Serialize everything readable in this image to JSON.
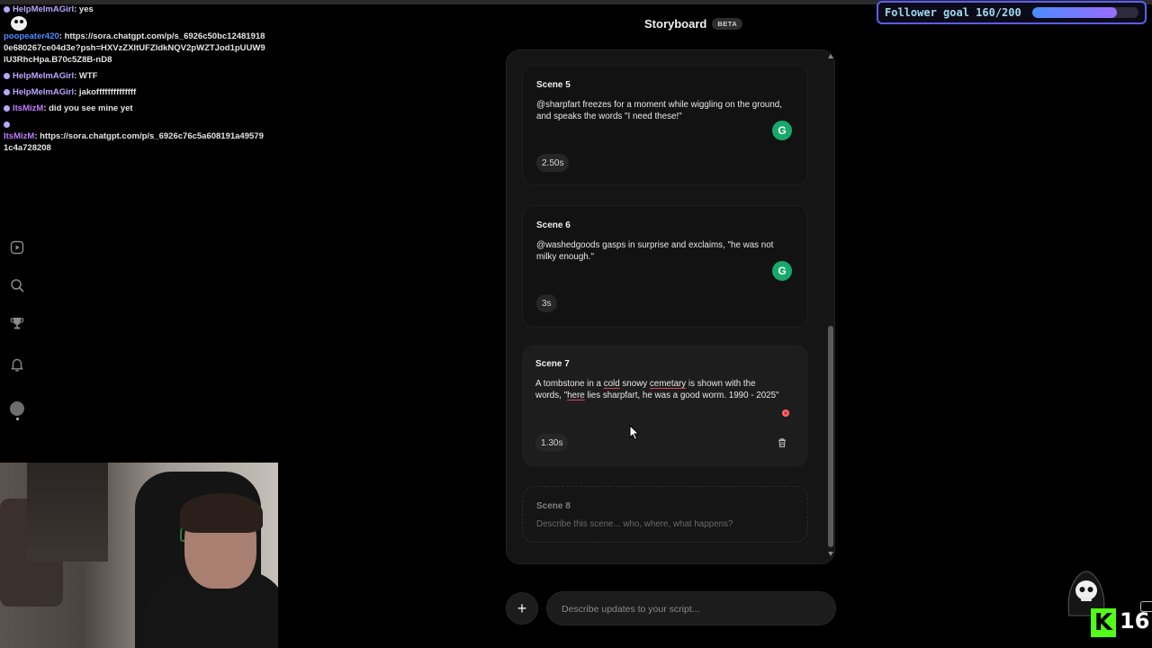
{
  "chat": {
    "messages": [
      {
        "user": "HelpMeImAGirl",
        "text": "yes",
        "color": "#b9a6ff"
      },
      {
        "user": "poopeater420",
        "text": "https://sora.chatgpt.com/p/s_6926c50bc124819180e680267ce04d3e?psh=HXVzZXItUFZldkNQV2pWZTJod1pUUW9lU3RhcHpa.B70c5Z8B-nD8",
        "color": "#4f8cff"
      },
      {
        "user": "HelpMeImAGirl",
        "text": "WTF",
        "color": "#b9a6ff"
      },
      {
        "user": "HelpMeImAGirl",
        "text": "jakoffffffffffffff",
        "color": "#b9a6ff"
      },
      {
        "user": "ItsMizM",
        "text": "did you see mine yet",
        "color": "#c07cff"
      },
      {
        "user": "ItsMizM",
        "text": "https://sora.chatgpt.com/p/s_6926c76c5a608191a495791c4a728208",
        "color": "#c07cff"
      }
    ]
  },
  "nav": {
    "icons": [
      "play-icon",
      "search-icon",
      "trophy-icon",
      "bell-icon",
      "avatar"
    ]
  },
  "header": {
    "title": "Storyboard",
    "badge": "BETA"
  },
  "follower_goal": {
    "label": "Follower goal 160/200",
    "current": 160,
    "target": 200,
    "progress": 0.8,
    "border_color": "#5b5ef0",
    "fill_color": "#7a7cff"
  },
  "scenes": [
    {
      "title": "Scene 5",
      "text": "@sharpfart freezes for a moment while wiggling on the ground, and speaks the words \"I need these!\"",
      "duration": "2.50s"
    },
    {
      "title": "Scene 6",
      "text": "@washedgoods gasps in surprise and exclaims, \"he was not milky enough.\"",
      "duration": "3s"
    },
    {
      "title": "Scene 7",
      "text_parts": [
        "A tombstone in a ",
        "cold",
        " snowy ",
        "cemetary",
        " is shown with the words, \"",
        "here",
        " lies sharpfart, he was a good worm. 1990 - 2025\""
      ],
      "duration": "1.30s"
    },
    {
      "title": "Scene 8",
      "placeholder": "Describe this scene... who, where, what happens?"
    }
  ],
  "composer": {
    "add_label": "+",
    "placeholder": "Describe updates to your script..."
  },
  "kick": {
    "logo": "K",
    "count": "16"
  },
  "colors": {
    "accent_green": "#17a86b",
    "kick_green": "#53fc18",
    "recording_red": "#e0333d"
  }
}
